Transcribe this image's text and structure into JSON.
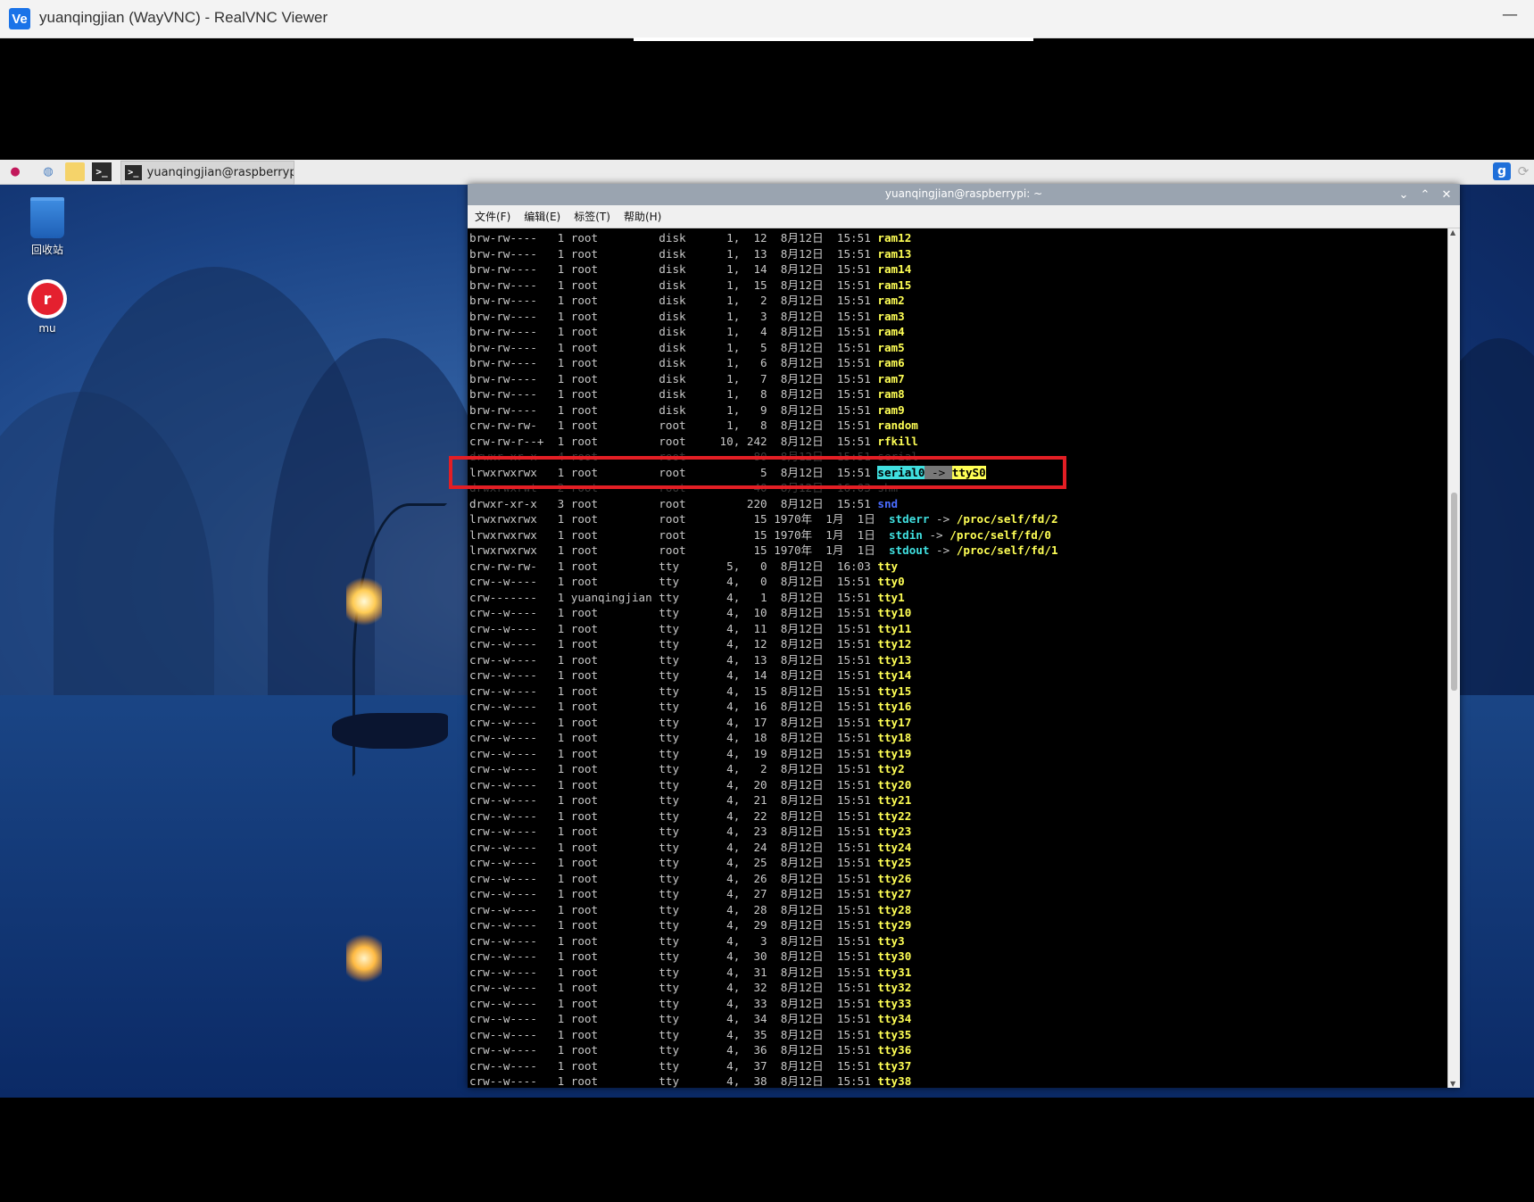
{
  "vnc": {
    "logo": "Ve",
    "title": "yuanqingjian (WayVNC) - RealVNC Viewer",
    "minimize": "—"
  },
  "taskbar": {
    "task_label": "yuanqingjian@raspberryp..",
    "task_icon": ">_",
    "term_icon": ">_",
    "g_icon": "g"
  },
  "desktop": {
    "trash_label": "回收站",
    "mu_label": "mu",
    "mu_icon_glyph": "r"
  },
  "terminal": {
    "title": "yuanqingjian@raspberrypi: ~",
    "menu": [
      "文件(F)",
      "编辑(E)",
      "标签(T)",
      "帮助(H)"
    ],
    "lines": [
      {
        "text": "brw-rw----   1 root         disk      1,  12  8月12日  15:51 ",
        "name": "ram12",
        "cls": "n"
      },
      {
        "text": "brw-rw----   1 root         disk      1,  13  8月12日  15:51 ",
        "name": "ram13",
        "cls": "n"
      },
      {
        "text": "brw-rw----   1 root         disk      1,  14  8月12日  15:51 ",
        "name": "ram14",
        "cls": "n"
      },
      {
        "text": "brw-rw----   1 root         disk      1,  15  8月12日  15:51 ",
        "name": "ram15",
        "cls": "n"
      },
      {
        "text": "brw-rw----   1 root         disk      1,   2  8月12日  15:51 ",
        "name": "ram2",
        "cls": "n"
      },
      {
        "text": "brw-rw----   1 root         disk      1,   3  8月12日  15:51 ",
        "name": "ram3",
        "cls": "n"
      },
      {
        "text": "brw-rw----   1 root         disk      1,   4  8月12日  15:51 ",
        "name": "ram4",
        "cls": "n"
      },
      {
        "text": "brw-rw----   1 root         disk      1,   5  8月12日  15:51 ",
        "name": "ram5",
        "cls": "n"
      },
      {
        "text": "brw-rw----   1 root         disk      1,   6  8月12日  15:51 ",
        "name": "ram6",
        "cls": "n"
      },
      {
        "text": "brw-rw----   1 root         disk      1,   7  8月12日  15:51 ",
        "name": "ram7",
        "cls": "n"
      },
      {
        "text": "brw-rw----   1 root         disk      1,   8  8月12日  15:51 ",
        "name": "ram8",
        "cls": "n"
      },
      {
        "text": "brw-rw----   1 root         disk      1,   9  8月12日  15:51 ",
        "name": "ram9",
        "cls": "n"
      },
      {
        "text": "crw-rw-rw-   1 root         root      1,   8  8月12日  15:51 ",
        "name": "random",
        "cls": "n"
      },
      {
        "text": "crw-rw-r--+  1 root         root     10, 242  8月12日  15:51 ",
        "name": "rfkill",
        "cls": "n"
      },
      {
        "text": "drwxr-xr-x   4 root         root          80  8月12日  15:51 ",
        "name": "serial",
        "cls": "faint"
      },
      {
        "text": "lrwxrwxrwx   1 root         root           5  8月12日  15:51 ",
        "name": "serial0",
        "cls": "hl-cyan",
        "arrow": " -> ",
        "target": "ttyS0",
        "target_cls": "hl-yel"
      },
      {
        "text": "drwxrwxrwt   2 root         root          40  8月12日  16:03 ",
        "name": "shm",
        "cls": "faint"
      },
      {
        "text": "drwxr-xr-x   3 root         root         220  8月12日  15:51 ",
        "name": "snd",
        "cls": "nb"
      },
      {
        "text": "lrwxrwxrwx   1 root         root          15 1970年  1月  1日  ",
        "name": "stderr",
        "cls": "nc",
        "arrow": " -> ",
        "target": "/proc/self/fd/2",
        "target_cls": "t"
      },
      {
        "text": "lrwxrwxrwx   1 root         root          15 1970年  1月  1日  ",
        "name": "stdin",
        "cls": "nc",
        "arrow": " -> ",
        "target": "/proc/self/fd/0",
        "target_cls": "t"
      },
      {
        "text": "lrwxrwxrwx   1 root         root          15 1970年  1月  1日  ",
        "name": "stdout",
        "cls": "nc",
        "arrow": " -> ",
        "target": "/proc/self/fd/1",
        "target_cls": "t"
      },
      {
        "text": "crw-rw-rw-   1 root         tty       5,   0  8月12日  16:03 ",
        "name": "tty",
        "cls": "n"
      },
      {
        "text": "crw--w----   1 root         tty       4,   0  8月12日  15:51 ",
        "name": "tty0",
        "cls": "n"
      },
      {
        "text": "crw-------   1 yuanqingjian tty       4,   1  8月12日  15:51 ",
        "name": "tty1",
        "cls": "n"
      },
      {
        "text": "crw--w----   1 root         tty       4,  10  8月12日  15:51 ",
        "name": "tty10",
        "cls": "n"
      },
      {
        "text": "crw--w----   1 root         tty       4,  11  8月12日  15:51 ",
        "name": "tty11",
        "cls": "n"
      },
      {
        "text": "crw--w----   1 root         tty       4,  12  8月12日  15:51 ",
        "name": "tty12",
        "cls": "n"
      },
      {
        "text": "crw--w----   1 root         tty       4,  13  8月12日  15:51 ",
        "name": "tty13",
        "cls": "n"
      },
      {
        "text": "crw--w----   1 root         tty       4,  14  8月12日  15:51 ",
        "name": "tty14",
        "cls": "n"
      },
      {
        "text": "crw--w----   1 root         tty       4,  15  8月12日  15:51 ",
        "name": "tty15",
        "cls": "n"
      },
      {
        "text": "crw--w----   1 root         tty       4,  16  8月12日  15:51 ",
        "name": "tty16",
        "cls": "n"
      },
      {
        "text": "crw--w----   1 root         tty       4,  17  8月12日  15:51 ",
        "name": "tty17",
        "cls": "n"
      },
      {
        "text": "crw--w----   1 root         tty       4,  18  8月12日  15:51 ",
        "name": "tty18",
        "cls": "n"
      },
      {
        "text": "crw--w----   1 root         tty       4,  19  8月12日  15:51 ",
        "name": "tty19",
        "cls": "n"
      },
      {
        "text": "crw--w----   1 root         tty       4,   2  8月12日  15:51 ",
        "name": "tty2",
        "cls": "n"
      },
      {
        "text": "crw--w----   1 root         tty       4,  20  8月12日  15:51 ",
        "name": "tty20",
        "cls": "n"
      },
      {
        "text": "crw--w----   1 root         tty       4,  21  8月12日  15:51 ",
        "name": "tty21",
        "cls": "n"
      },
      {
        "text": "crw--w----   1 root         tty       4,  22  8月12日  15:51 ",
        "name": "tty22",
        "cls": "n"
      },
      {
        "text": "crw--w----   1 root         tty       4,  23  8月12日  15:51 ",
        "name": "tty23",
        "cls": "n"
      },
      {
        "text": "crw--w----   1 root         tty       4,  24  8月12日  15:51 ",
        "name": "tty24",
        "cls": "n"
      },
      {
        "text": "crw--w----   1 root         tty       4,  25  8月12日  15:51 ",
        "name": "tty25",
        "cls": "n"
      },
      {
        "text": "crw--w----   1 root         tty       4,  26  8月12日  15:51 ",
        "name": "tty26",
        "cls": "n"
      },
      {
        "text": "crw--w----   1 root         tty       4,  27  8月12日  15:51 ",
        "name": "tty27",
        "cls": "n"
      },
      {
        "text": "crw--w----   1 root         tty       4,  28  8月12日  15:51 ",
        "name": "tty28",
        "cls": "n"
      },
      {
        "text": "crw--w----   1 root         tty       4,  29  8月12日  15:51 ",
        "name": "tty29",
        "cls": "n"
      },
      {
        "text": "crw--w----   1 root         tty       4,   3  8月12日  15:51 ",
        "name": "tty3",
        "cls": "n"
      },
      {
        "text": "crw--w----   1 root         tty       4,  30  8月12日  15:51 ",
        "name": "tty30",
        "cls": "n"
      },
      {
        "text": "crw--w----   1 root         tty       4,  31  8月12日  15:51 ",
        "name": "tty31",
        "cls": "n"
      },
      {
        "text": "crw--w----   1 root         tty       4,  32  8月12日  15:51 ",
        "name": "tty32",
        "cls": "n"
      },
      {
        "text": "crw--w----   1 root         tty       4,  33  8月12日  15:51 ",
        "name": "tty33",
        "cls": "n"
      },
      {
        "text": "crw--w----   1 root         tty       4,  34  8月12日  15:51 ",
        "name": "tty34",
        "cls": "n"
      },
      {
        "text": "crw--w----   1 root         tty       4,  35  8月12日  15:51 ",
        "name": "tty35",
        "cls": "n"
      },
      {
        "text": "crw--w----   1 root         tty       4,  36  8月12日  15:51 ",
        "name": "tty36",
        "cls": "n"
      },
      {
        "text": "crw--w----   1 root         tty       4,  37  8月12日  15:51 ",
        "name": "tty37",
        "cls": "n"
      },
      {
        "text": "crw--w----   1 root         tty       4,  38  8月12日  15:51 ",
        "name": "tty38",
        "cls": "n"
      }
    ]
  },
  "colors": {
    "highlight_box": "#e31e24",
    "file_yellow": "#ffff55",
    "link_cyan": "#40e0e0",
    "dir_blue": "#4a6cff"
  }
}
